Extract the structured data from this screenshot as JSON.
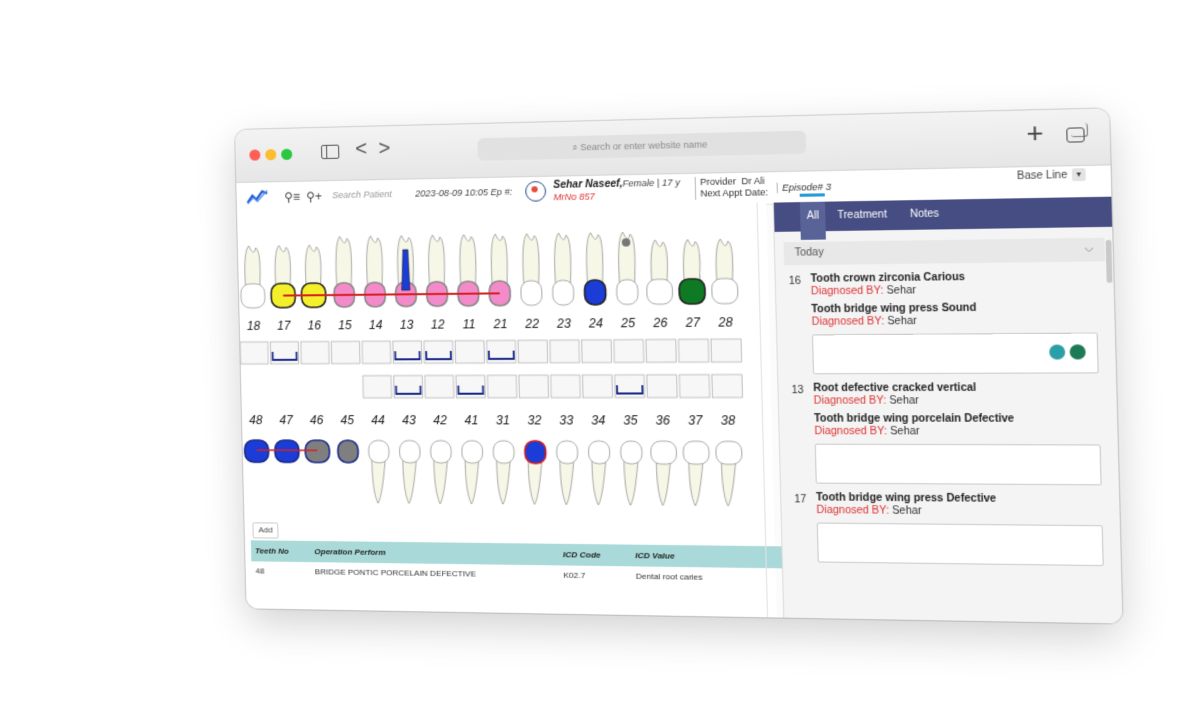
{
  "browser": {
    "url_placeholder": "Search or enter website name",
    "back_glyph": "<",
    "forward_glyph": ">",
    "new_tab_glyph": "+"
  },
  "header": {
    "search_placeholder": "Search Patient",
    "appointment": "2023-08-09 10:05 Ep #:",
    "patient_name": "Sehar Naseef,",
    "patient_meta": "Female | 17 y",
    "mrno": "MrNo 857",
    "provider_label": "Provider",
    "provider_value": "Dr Ali",
    "next_appt_label": "Next Appt Date:",
    "episode": "Episode# 3",
    "baseline": "Base Line"
  },
  "chart": {
    "upper_numbers": [
      "18",
      "17",
      "16",
      "15",
      "14",
      "13",
      "12",
      "11",
      "21",
      "22",
      "23",
      "24",
      "25",
      "26",
      "27",
      "28"
    ],
    "lower_numbers": [
      "48",
      "47",
      "46",
      "45",
      "44",
      "43",
      "42",
      "41",
      "31",
      "32",
      "33",
      "34",
      "35",
      "36",
      "37",
      "38"
    ],
    "add_button": "Add",
    "colors": {
      "yellow": "#f3ef2a",
      "pink": "#f38ac9",
      "blue": "#1b3cd6",
      "green": "#0e7a23",
      "gray": "#7f7f7f",
      "bridge": "#d82020",
      "tooth": "#f7f7e8"
    }
  },
  "table": {
    "headers": [
      "Teeth No",
      "Operation Perform",
      "ICD Code",
      "ICD Value"
    ],
    "rows": [
      [
        "48",
        "BRIDGE PONTIC PORCELAIN DEFECTIVE",
        "K02.7",
        "Dental root caries"
      ]
    ]
  },
  "panel": {
    "tabs": [
      "All",
      "Treatment",
      "Notes"
    ],
    "section": "Today",
    "entries": [
      {
        "num": "16",
        "items": [
          {
            "title": "Tooth crown zirconia Carious",
            "by_label": "Diagnosed BY:",
            "by_name": "Sehar"
          },
          {
            "title": "Tooth bridge wing press Sound",
            "by_label": "Diagnosed BY:",
            "by_name": "Sehar"
          }
        ]
      },
      {
        "num": "13",
        "items": [
          {
            "title": "Root defective cracked vertical",
            "by_label": "Diagnosed BY:",
            "by_name": "Sehar"
          },
          {
            "title": "Tooth bridge wing porcelain Defective",
            "by_label": "Diagnosed BY:",
            "by_name": "Sehar"
          }
        ]
      },
      {
        "num": "17",
        "items": [
          {
            "title": "Tooth bridge wing press Defective",
            "by_label": "Diagnosed BY:",
            "by_name": "Sehar"
          }
        ]
      }
    ]
  }
}
